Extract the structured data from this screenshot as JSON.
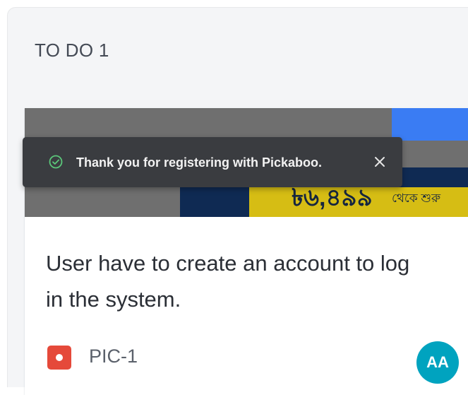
{
  "column": {
    "title": "TO DO 1"
  },
  "card": {
    "image": {
      "price_text": "৳৬,৪৯৯",
      "suffix_text": "থেকে শুরু"
    },
    "summary": "User have to create an account to log in the system.",
    "issue_type_icon": "bug-icon",
    "issue_key": "PIC-1",
    "assignee_initials": "AA"
  },
  "toast": {
    "message": "Thank you for registering with Pickaboo.",
    "icon": "check-circle-icon",
    "close_icon": "close-icon"
  },
  "colors": {
    "column_bg": "#f4f5f7",
    "toast_bg": "#3a3c40",
    "success_green": "#5bc77a",
    "issue_type_red": "#e5493a",
    "avatar_teal": "#00a3bf"
  }
}
